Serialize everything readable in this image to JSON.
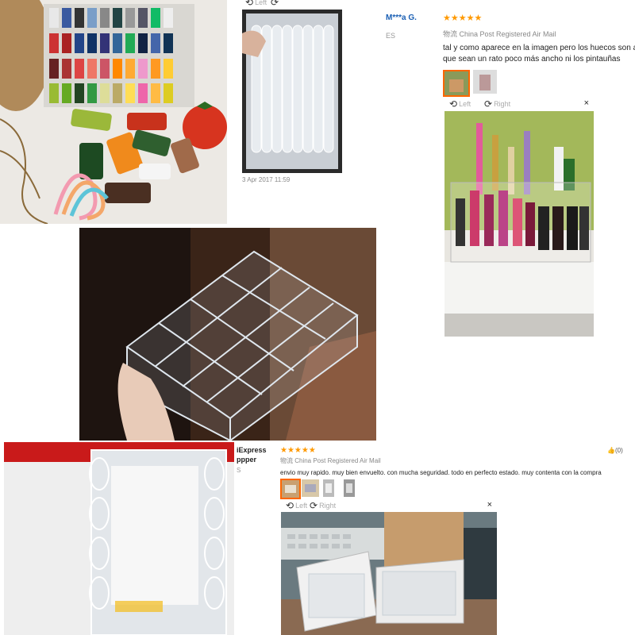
{
  "review_top": {
    "reviewer": "M***a G.",
    "country_code": "ES",
    "stars": "★★★★★",
    "logistics": "物流 China Post Registered Air Mail",
    "text_line1": "tal y como aparece en la imagen pero los huecos son a",
    "text_line2": "que sean un rato poco más ancho ni los pintauñas",
    "viewer": {
      "left_label": "Left",
      "right_label": "Right",
      "close": "×"
    }
  },
  "photo_bubble_wrap": {
    "date": "3 Apr 2017 11:59"
  },
  "viewer_small": {
    "left_label": "Left",
    "right_label": "Right"
  },
  "review_bottom": {
    "header_line1": "iExpress",
    "header_line2": "ppper",
    "country_code": "S",
    "stars": "★★★★★",
    "logistics": "物流 China Post Registered Air Mail",
    "likes": "(0)",
    "text": "envio muy rapido. muy bien envuelto. con mucha seguridad. todo en perfecto estado. muy contenta con la compra",
    "viewer": {
      "left_label": "Left",
      "right_label": "Right",
      "close": "×"
    }
  },
  "icons": {
    "rotate_left": "rotate-left-icon",
    "rotate_right": "rotate-right-icon",
    "close": "close-icon",
    "thumbs_up": "thumbs-up-icon"
  },
  "colors": {
    "star": "#ff9900",
    "reviewer_link": "#1a5fb4",
    "active_thumb": "#ff6600"
  }
}
